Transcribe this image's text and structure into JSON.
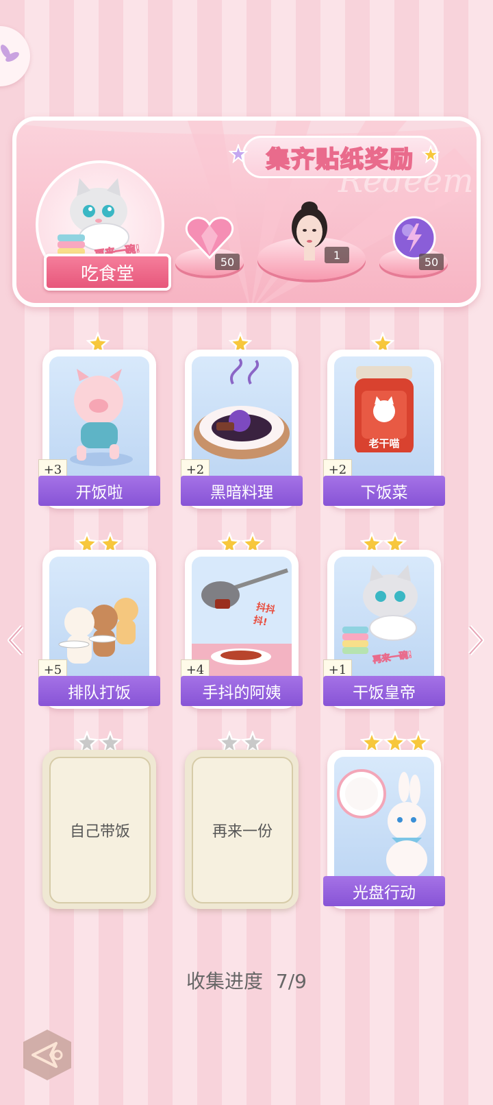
{
  "banner": {
    "canteen_label": "吃食堂",
    "canteen_sticker_text": "再来一碗!",
    "title": "集齐贴纸奖励",
    "watermark": "Redeem",
    "rewards": [
      {
        "icon": "heart-gem-icon",
        "count": "50"
      },
      {
        "icon": "avatar-portrait-icon",
        "count": "1"
      },
      {
        "icon": "lightning-orb-icon",
        "count": "50"
      }
    ]
  },
  "cards": [
    {
      "name": "开饭啦",
      "count": "+3",
      "stars": 1,
      "locked": false,
      "icon": "running-pig-icon"
    },
    {
      "name": "黑暗料理",
      "count": "+2",
      "stars": 1,
      "locked": false,
      "icon": "dark-dish-icon"
    },
    {
      "name": "下饭菜",
      "count": "+2",
      "stars": 1,
      "locked": false,
      "icon": "chili-jar-icon",
      "art_text": "老干喵"
    },
    {
      "name": "排队打饭",
      "count": "+5",
      "stars": 2,
      "locked": false,
      "icon": "queue-cats-icon"
    },
    {
      "name": "手抖的阿姨",
      "count": "+4",
      "stars": 2,
      "locked": false,
      "icon": "ladle-icon",
      "art_text": "抖抖抖!"
    },
    {
      "name": "干饭皇帝",
      "count": "+1",
      "stars": 2,
      "locked": false,
      "icon": "eating-cat-icon",
      "art_text": "再来一碗!"
    },
    {
      "name": "自己带饭",
      "count": "",
      "stars": 2,
      "locked": true,
      "icon": ""
    },
    {
      "name": "再来一份",
      "count": "",
      "stars": 2,
      "locked": true,
      "icon": ""
    },
    {
      "name": "光盘行动",
      "count": "",
      "stars": 3,
      "locked": false,
      "icon": "bunny-plate-icon"
    }
  ],
  "progress": {
    "label": "收集进度",
    "value": "7/9"
  },
  "colors": {
    "accent_purple": "#8754d6",
    "accent_pink": "#e7577b",
    "star_gold": "#f7c73c",
    "star_gray": "#c9c9c9"
  }
}
